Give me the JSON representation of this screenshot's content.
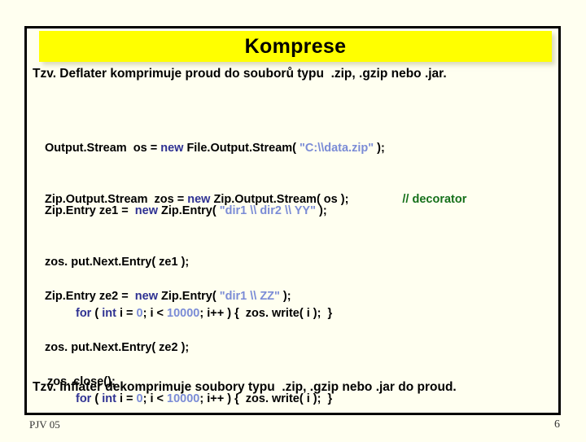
{
  "slide": {
    "title": "Komprese",
    "lead_top": "Tzv. Deflater komprimuje proud do souborů typu  .zip, .gzip nebo .jar.",
    "lead_bottom": "Tzv. Inflater dekomprimuje soubory typu  .zip, .gzip nebo .jar do proud.",
    "colors": {
      "background": "#fffff0",
      "title_band": "#ffff00",
      "frame_border": "#000000",
      "keyword": "#2e3192",
      "string": "#7b8cd6",
      "number": "#7b8cd6",
      "comment": "#15701a",
      "text": "#000000"
    }
  },
  "code": {
    "block1": {
      "line1": {
        "p1": "Output.Stream  os = ",
        "kw": "new",
        "p2": " File.Output.Stream( ",
        "str": "\"C:\\\\data.zip\"",
        "p3": " );"
      },
      "line2": {
        "p1": "Zip.Output.Stream  zos = ",
        "kw": "new",
        "p2": " Zip.Output.Stream( os );",
        "comment": "// decorator"
      }
    },
    "block2": {
      "line1": {
        "p1": "Zip.Entry ze1 =  ",
        "kw": "new",
        "p2": " Zip.Entry( ",
        "str": "\"dir1 \\\\ dir2 \\\\ YY\"",
        "p3": " );"
      },
      "line2": "zos. put.Next.Entry( ze1 );",
      "line3": {
        "kw1": "for",
        "p1": " ( ",
        "kw2": "int",
        "p2": " i = ",
        "num1": "0",
        "p3": "; i < ",
        "num2": "10000",
        "p4": "; i++ ) {  zos. write( i );  }"
      }
    },
    "block3": {
      "line1": {
        "p1": "Zip.Entry ze2 =  ",
        "kw": "new",
        "p2": " Zip.Entry( ",
        "str": "\"dir1 \\\\ ZZ\"",
        "p3": " );"
      },
      "line2": "zos. put.Next.Entry( ze2 );",
      "line3": {
        "kw1": "for",
        "p1": " ( ",
        "kw2": "int",
        "p2": " i = ",
        "num1": "0",
        "p3": "; i < ",
        "num2": "10000",
        "p4": "; i++ ) {  zos. write( i );  }"
      }
    },
    "block4": {
      "line1": "zos. close();"
    }
  },
  "footer": {
    "left": "PJV 05",
    "page": "6"
  }
}
